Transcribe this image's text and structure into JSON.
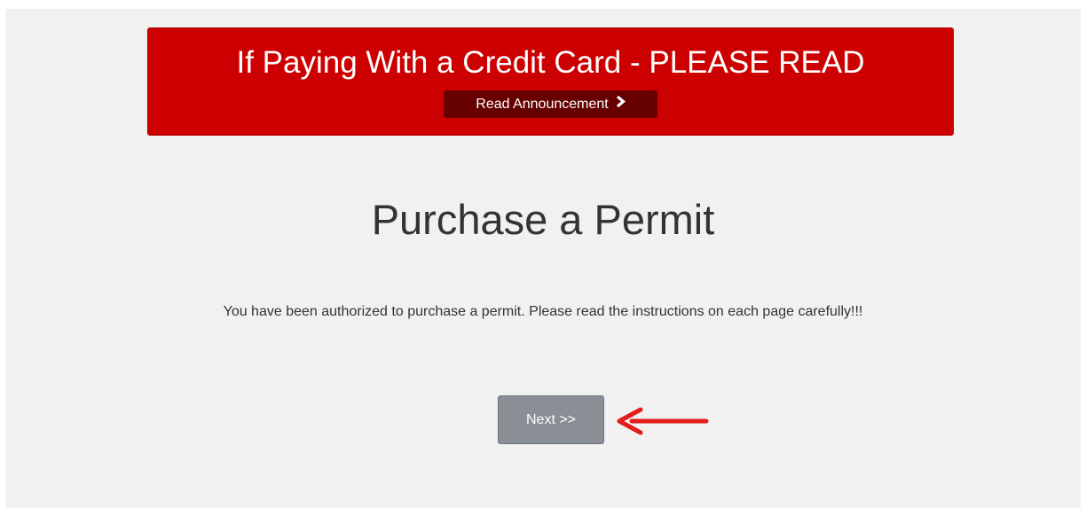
{
  "banner": {
    "title": "If Paying With a Credit Card - PLEASE READ",
    "button_label": "Read Announcement",
    "button_icon": "chevron-right-icon",
    "background_color": "#cc0000",
    "button_color": "#660000"
  },
  "main": {
    "title": "Purchase a Permit",
    "instructions": "You have been authorized to purchase a permit. Please read the instructions on each page carefully!!!",
    "next_button_label": "Next >>"
  },
  "annotation": {
    "icon": "red-arrow-icon",
    "color": "#e31c1c"
  }
}
